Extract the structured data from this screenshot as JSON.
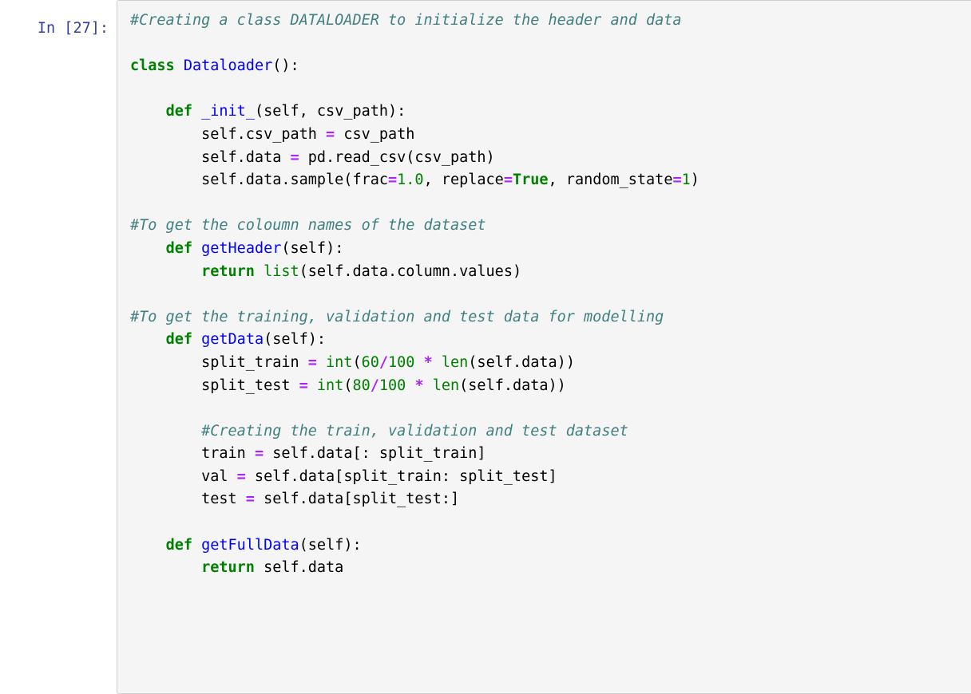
{
  "cell": {
    "prompt_label": "In [27]:",
    "execution_count": 27,
    "cell_type": "code",
    "language": "python"
  },
  "colors": {
    "page_background": "#ffffff",
    "cell_background": "#f5f5f5",
    "cell_border": "#cfcfcf",
    "prompt_text": "#303f9f",
    "comment": "#408080",
    "keyword": "#008000",
    "function_name": "#0000ff",
    "class_name": "#0000ff",
    "builtin": "#008000",
    "operator": "#aa22ff",
    "number": "#008000",
    "plain_text": "#000000"
  },
  "code": {
    "lines": [
      {
        "id": "l01",
        "tokens": [
          {
            "t": "comment",
            "s": "#Creating a class DATALOADER to initialize the header and data"
          }
        ]
      },
      {
        "id": "l02",
        "tokens": []
      },
      {
        "id": "l03",
        "tokens": [
          {
            "t": "keyword",
            "s": "class"
          },
          {
            "t": "plain",
            "s": " "
          },
          {
            "t": "classname",
            "s": "Dataloader"
          },
          {
            "t": "punct",
            "s": "():"
          }
        ]
      },
      {
        "id": "l04",
        "tokens": []
      },
      {
        "id": "l05",
        "tokens": [
          {
            "t": "plain",
            "s": "    "
          },
          {
            "t": "keyword",
            "s": "def"
          },
          {
            "t": "plain",
            "s": " "
          },
          {
            "t": "defname",
            "s": "_init_"
          },
          {
            "t": "punct",
            "s": "(self, csv_path):"
          }
        ]
      },
      {
        "id": "l06",
        "tokens": [
          {
            "t": "plain",
            "s": "        self.csv_path "
          },
          {
            "t": "operator",
            "s": "="
          },
          {
            "t": "plain",
            "s": " csv_path"
          }
        ]
      },
      {
        "id": "l07",
        "tokens": [
          {
            "t": "plain",
            "s": "        self.data "
          },
          {
            "t": "operator",
            "s": "="
          },
          {
            "t": "plain",
            "s": " pd.read_csv(csv_path)"
          }
        ]
      },
      {
        "id": "l08",
        "tokens": [
          {
            "t": "plain",
            "s": "        self.data.sample(frac"
          },
          {
            "t": "operator",
            "s": "="
          },
          {
            "t": "number",
            "s": "1.0"
          },
          {
            "t": "plain",
            "s": ", replace"
          },
          {
            "t": "operator",
            "s": "="
          },
          {
            "t": "keyword",
            "s": "True"
          },
          {
            "t": "plain",
            "s": ", random_state"
          },
          {
            "t": "operator",
            "s": "="
          },
          {
            "t": "number",
            "s": "1"
          },
          {
            "t": "punct",
            "s": ")"
          }
        ]
      },
      {
        "id": "l09",
        "tokens": []
      },
      {
        "id": "l10",
        "tokens": [
          {
            "t": "comment",
            "s": "#To get the coloumn names of the dataset"
          }
        ]
      },
      {
        "id": "l11",
        "tokens": [
          {
            "t": "plain",
            "s": "    "
          },
          {
            "t": "keyword",
            "s": "def"
          },
          {
            "t": "plain",
            "s": " "
          },
          {
            "t": "defname",
            "s": "getHeader"
          },
          {
            "t": "punct",
            "s": "(self):"
          }
        ]
      },
      {
        "id": "l12",
        "tokens": [
          {
            "t": "plain",
            "s": "        "
          },
          {
            "t": "keyword",
            "s": "return"
          },
          {
            "t": "plain",
            "s": " "
          },
          {
            "t": "builtin",
            "s": "list"
          },
          {
            "t": "punct",
            "s": "(self.data.column.values)"
          }
        ]
      },
      {
        "id": "l13",
        "tokens": []
      },
      {
        "id": "l14",
        "tokens": [
          {
            "t": "comment",
            "s": "#To get the training, validation and test data for modelling"
          }
        ]
      },
      {
        "id": "l15",
        "tokens": [
          {
            "t": "plain",
            "s": "    "
          },
          {
            "t": "keyword",
            "s": "def"
          },
          {
            "t": "plain",
            "s": " "
          },
          {
            "t": "defname",
            "s": "getData"
          },
          {
            "t": "punct",
            "s": "(self):"
          }
        ]
      },
      {
        "id": "l16",
        "tokens": [
          {
            "t": "plain",
            "s": "        split_train "
          },
          {
            "t": "operator",
            "s": "="
          },
          {
            "t": "plain",
            "s": " "
          },
          {
            "t": "builtin",
            "s": "int"
          },
          {
            "t": "punct",
            "s": "("
          },
          {
            "t": "number",
            "s": "60"
          },
          {
            "t": "operator",
            "s": "/"
          },
          {
            "t": "number",
            "s": "100"
          },
          {
            "t": "plain",
            "s": " "
          },
          {
            "t": "operator",
            "s": "*"
          },
          {
            "t": "plain",
            "s": " "
          },
          {
            "t": "builtin",
            "s": "len"
          },
          {
            "t": "punct",
            "s": "(self.data))"
          }
        ]
      },
      {
        "id": "l17",
        "tokens": [
          {
            "t": "plain",
            "s": "        split_test "
          },
          {
            "t": "operator",
            "s": "="
          },
          {
            "t": "plain",
            "s": " "
          },
          {
            "t": "builtin",
            "s": "int"
          },
          {
            "t": "punct",
            "s": "("
          },
          {
            "t": "number",
            "s": "80"
          },
          {
            "t": "operator",
            "s": "/"
          },
          {
            "t": "number",
            "s": "100"
          },
          {
            "t": "plain",
            "s": " "
          },
          {
            "t": "operator",
            "s": "*"
          },
          {
            "t": "plain",
            "s": " "
          },
          {
            "t": "builtin",
            "s": "len"
          },
          {
            "t": "punct",
            "s": "(self.data))"
          }
        ]
      },
      {
        "id": "l18",
        "tokens": []
      },
      {
        "id": "l19",
        "tokens": [
          {
            "t": "plain",
            "s": "        "
          },
          {
            "t": "comment",
            "s": "#Creating the train, validation and test dataset"
          }
        ]
      },
      {
        "id": "l20",
        "tokens": [
          {
            "t": "plain",
            "s": "        train "
          },
          {
            "t": "operator",
            "s": "="
          },
          {
            "t": "plain",
            "s": " self.data[: split_train]"
          }
        ]
      },
      {
        "id": "l21",
        "tokens": [
          {
            "t": "plain",
            "s": "        val "
          },
          {
            "t": "operator",
            "s": "="
          },
          {
            "t": "plain",
            "s": " self.data[split_train: split_test]"
          }
        ]
      },
      {
        "id": "l22",
        "tokens": [
          {
            "t": "plain",
            "s": "        test "
          },
          {
            "t": "operator",
            "s": "="
          },
          {
            "t": "plain",
            "s": " self.data[split_test:]"
          }
        ]
      },
      {
        "id": "l23",
        "tokens": []
      },
      {
        "id": "l24",
        "tokens": [
          {
            "t": "plain",
            "s": "    "
          },
          {
            "t": "keyword",
            "s": "def"
          },
          {
            "t": "plain",
            "s": " "
          },
          {
            "t": "defname",
            "s": "getFullData"
          },
          {
            "t": "punct",
            "s": "(self):"
          }
        ]
      },
      {
        "id": "l25",
        "tokens": [
          {
            "t": "plain",
            "s": "        "
          },
          {
            "t": "keyword",
            "s": "return"
          },
          {
            "t": "plain",
            "s": " self.data"
          }
        ]
      },
      {
        "id": "l26",
        "tokens": []
      },
      {
        "id": "l27",
        "tokens": []
      },
      {
        "id": "l28",
        "tokens": []
      }
    ]
  }
}
